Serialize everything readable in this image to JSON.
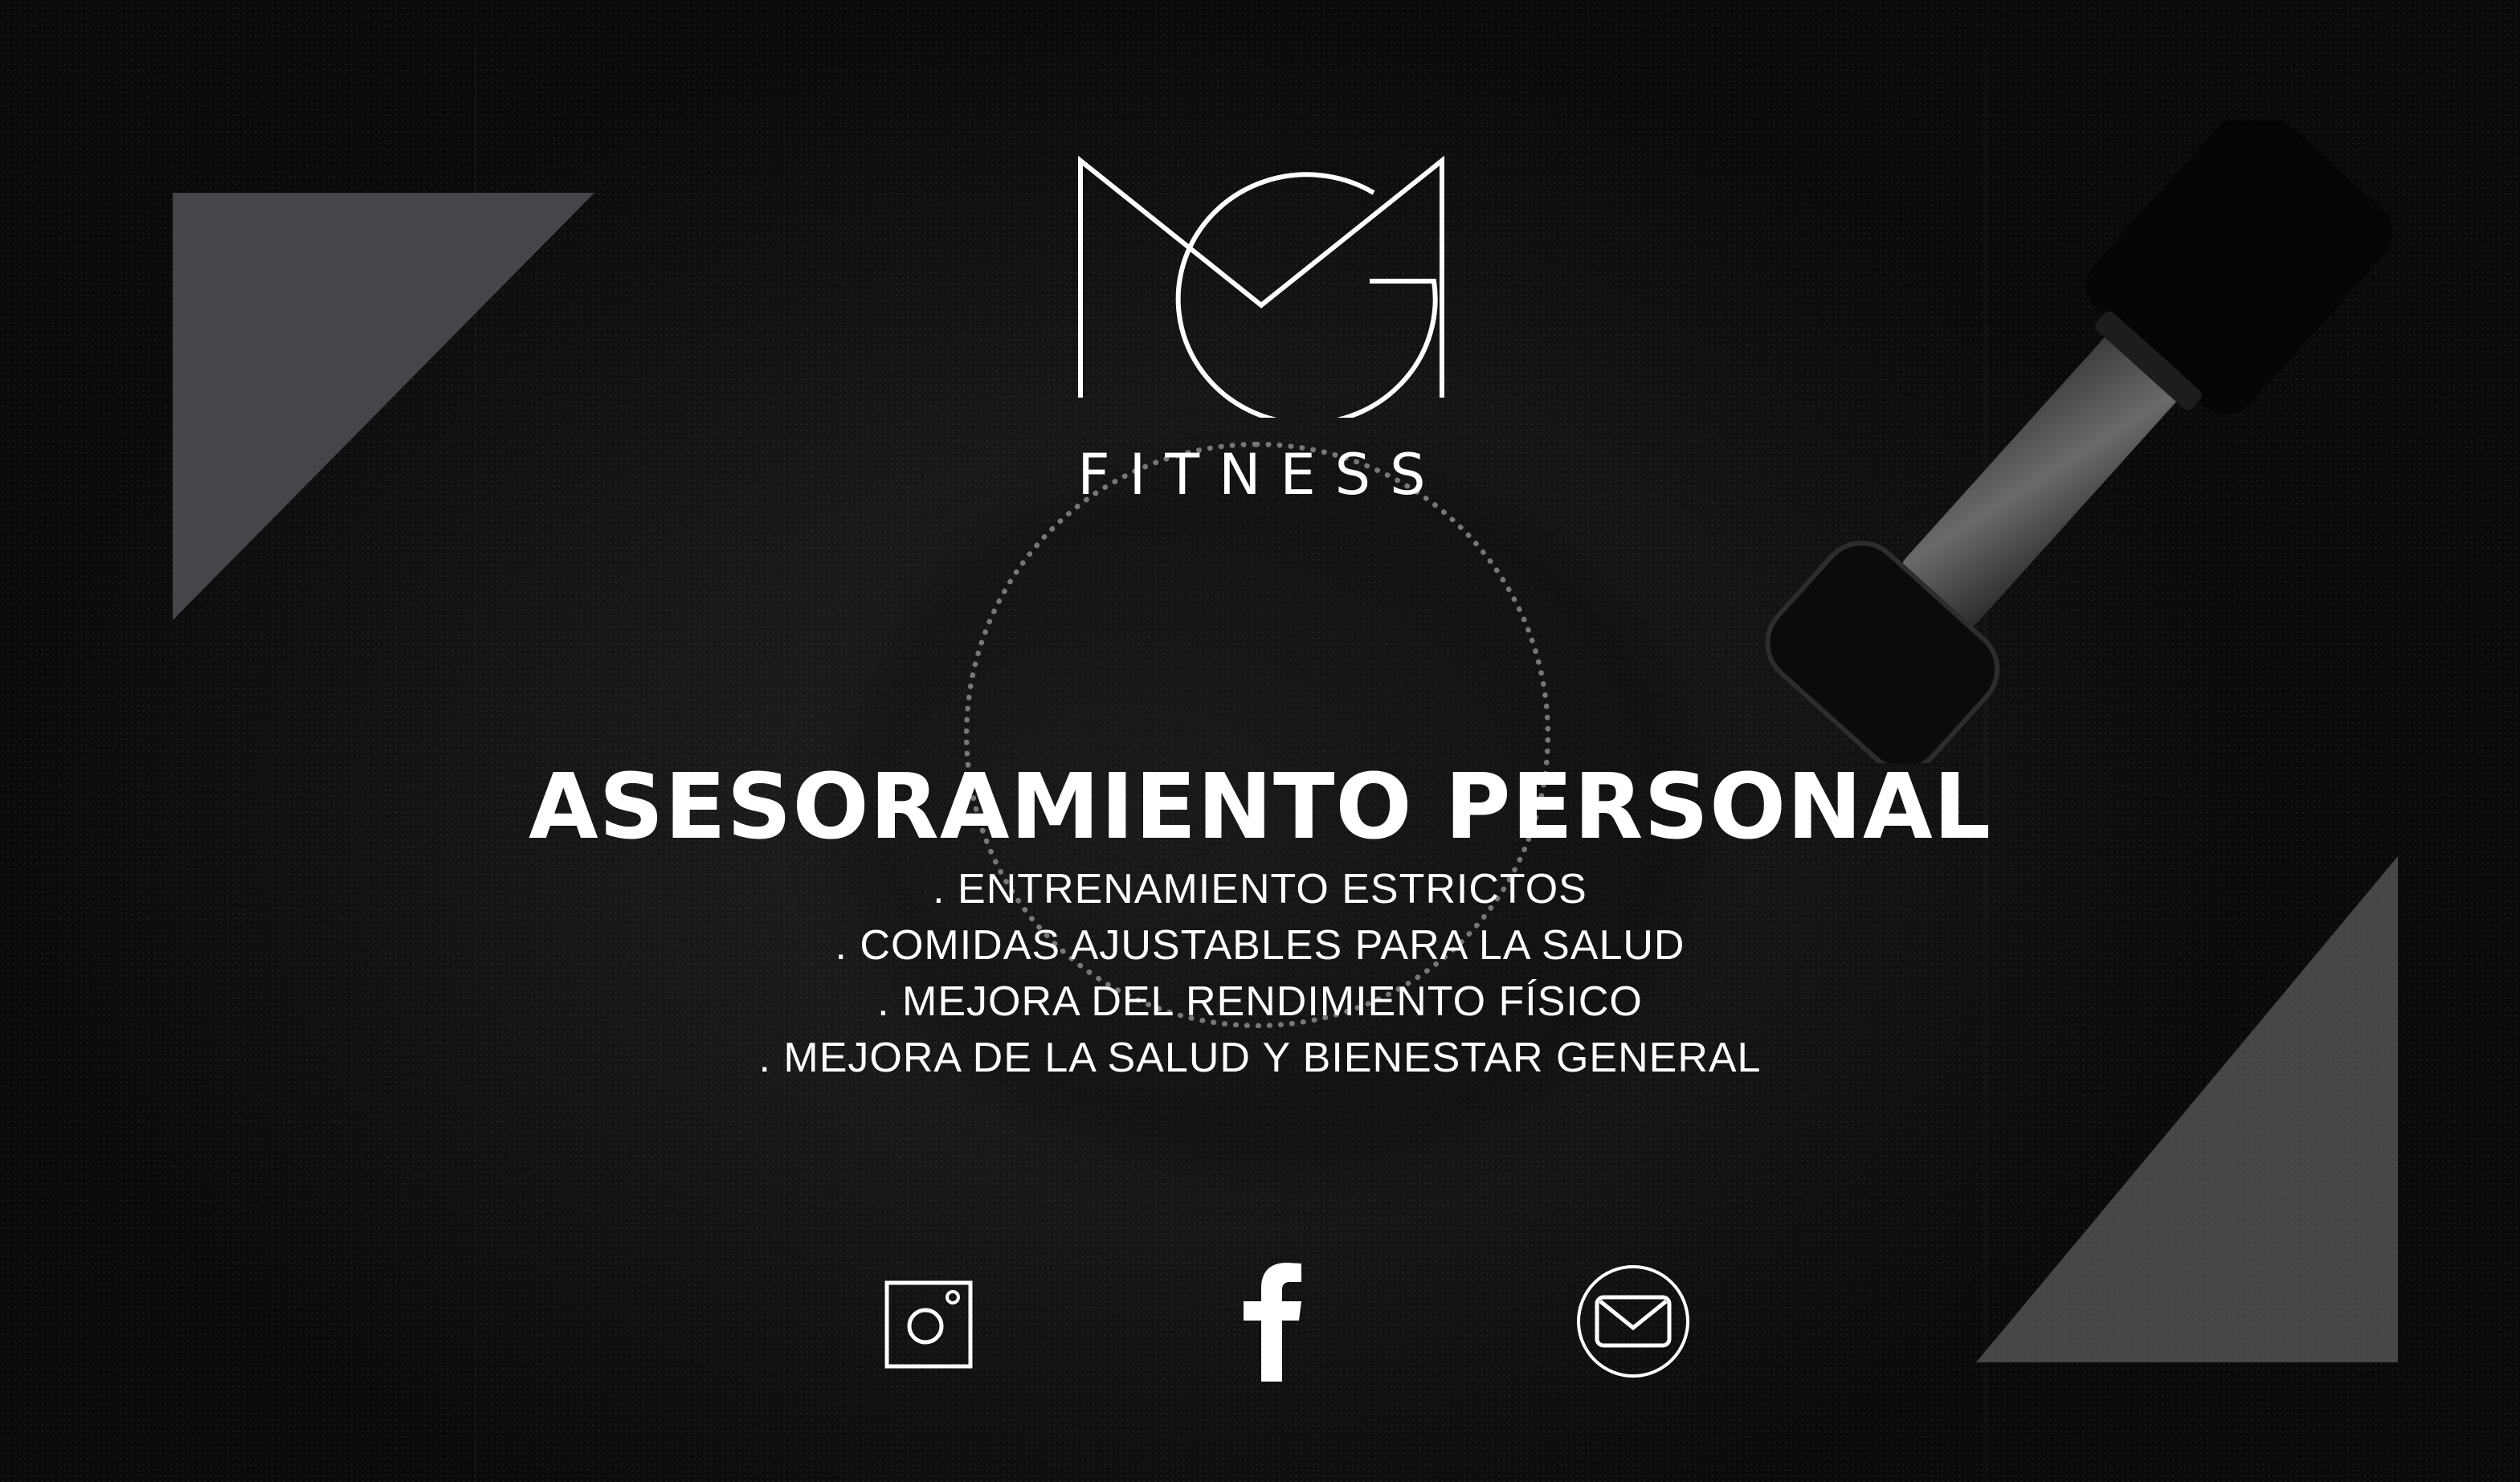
{
  "logo": {
    "icon": "mg-monogram-logo",
    "brand": "FITNESS"
  },
  "headline": "ASESORAMIENTO PERSONAL",
  "features": [
    ". ENTRENAMIENTO ESTRICTOS",
    ". COMIDAS AJUSTABLES PARA LA SALUD",
    ". MEJORA DEL RENDIMIENTO FÍSICO",
    ". MEJORA DE LA SALUD Y BIENESTAR GENERAL"
  ],
  "social": {
    "icons": [
      "instagram-icon",
      "facebook-icon",
      "mail-icon"
    ]
  },
  "colors": {
    "background": "#141414",
    "text": "#ffffff",
    "triangle_top_left": "#45454b",
    "triangle_bottom_right": "#6e6e6e"
  }
}
